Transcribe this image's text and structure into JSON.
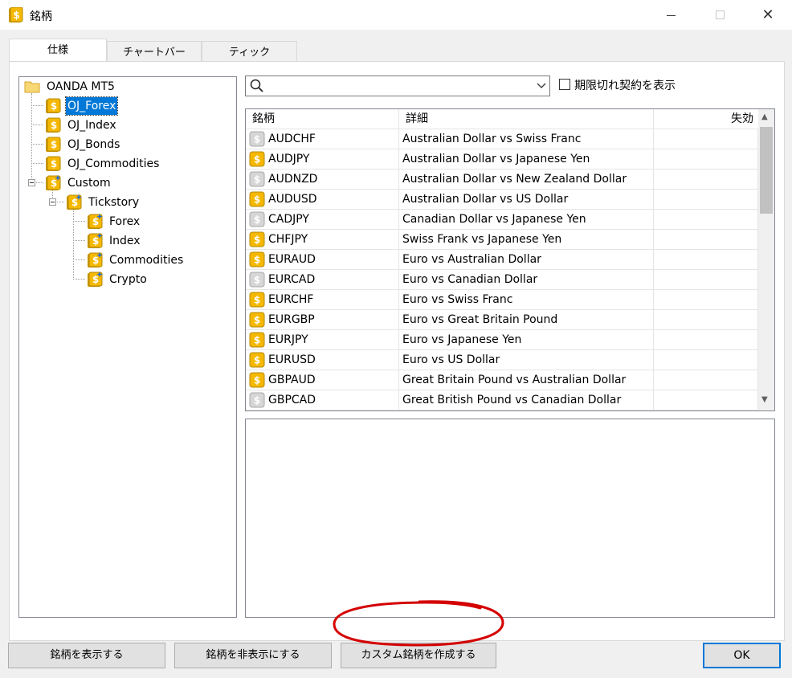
{
  "window": {
    "title": "銘柄"
  },
  "tabs": [
    {
      "label": "仕様",
      "active": true
    },
    {
      "label": "チャートバー",
      "active": false
    },
    {
      "label": "ティック",
      "active": false
    }
  ],
  "tree": {
    "root": "OANDA MT5",
    "items": [
      "OJ_Forex",
      "OJ_Index",
      "OJ_Bonds",
      "OJ_Commodities",
      "Custom",
      "Tickstory",
      "Forex",
      "Index",
      "Commodities",
      "Crypto"
    ],
    "selected": "OJ_Forex"
  },
  "search": {
    "value": "",
    "placeholder": ""
  },
  "expired_checkbox": {
    "label": "期限切れ契約を表示",
    "checked": false
  },
  "grid": {
    "columns": [
      "銘柄",
      "詳細",
      "失効"
    ],
    "rows": [
      {
        "symbol": "AUDCHF",
        "description": "Australian Dollar vs Swiss Franc",
        "expiration": "",
        "active": false
      },
      {
        "symbol": "AUDJPY",
        "description": "Australian Dollar vs Japanese Yen",
        "expiration": "",
        "active": true
      },
      {
        "symbol": "AUDNZD",
        "description": "Australian Dollar vs New Zealand Dollar",
        "expiration": "",
        "active": false
      },
      {
        "symbol": "AUDUSD",
        "description": "Australian Dollar vs US Dollar",
        "expiration": "",
        "active": true
      },
      {
        "symbol": "CADJPY",
        "description": "Canadian Dollar vs Japanese Yen",
        "expiration": "",
        "active": false
      },
      {
        "symbol": "CHFJPY",
        "description": "Swiss Frank vs Japanese Yen",
        "expiration": "",
        "active": true
      },
      {
        "symbol": "EURAUD",
        "description": "Euro vs Australian Dollar",
        "expiration": "",
        "active": true
      },
      {
        "symbol": "EURCAD",
        "description": "Euro vs Canadian Dollar",
        "expiration": "",
        "active": false
      },
      {
        "symbol": "EURCHF",
        "description": "Euro vs Swiss Franc",
        "expiration": "",
        "active": true
      },
      {
        "symbol": "EURGBP",
        "description": "Euro vs Great Britain Pound",
        "expiration": "",
        "active": true
      },
      {
        "symbol": "EURJPY",
        "description": "Euro vs Japanese Yen",
        "expiration": "",
        "active": true
      },
      {
        "symbol": "EURUSD",
        "description": "Euro vs US Dollar",
        "expiration": "",
        "active": true
      },
      {
        "symbol": "GBPAUD",
        "description": "Great Britain Pound vs Australian Dollar",
        "expiration": "",
        "active": true
      },
      {
        "symbol": "GBPCAD",
        "description": "Great British Pound vs Canadian Dollar",
        "expiration": "",
        "active": false
      }
    ]
  },
  "buttons": {
    "show": "銘柄を表示する",
    "hide": "銘柄を非表示にする",
    "create_custom": "カスタム銘柄を作成する",
    "ok": "OK"
  },
  "icons": {
    "app": "coin-icon",
    "folder": "folder-icon",
    "active_symbol": "gold-coin-icon",
    "inactive_symbol": "gray-coin-icon",
    "custom_symbol": "coin-star-icon"
  },
  "colors": {
    "selection": "#0078d7",
    "coin_active": "#f5b800",
    "coin_inactive": "#c8c8c8",
    "annotation": "#d40000"
  }
}
